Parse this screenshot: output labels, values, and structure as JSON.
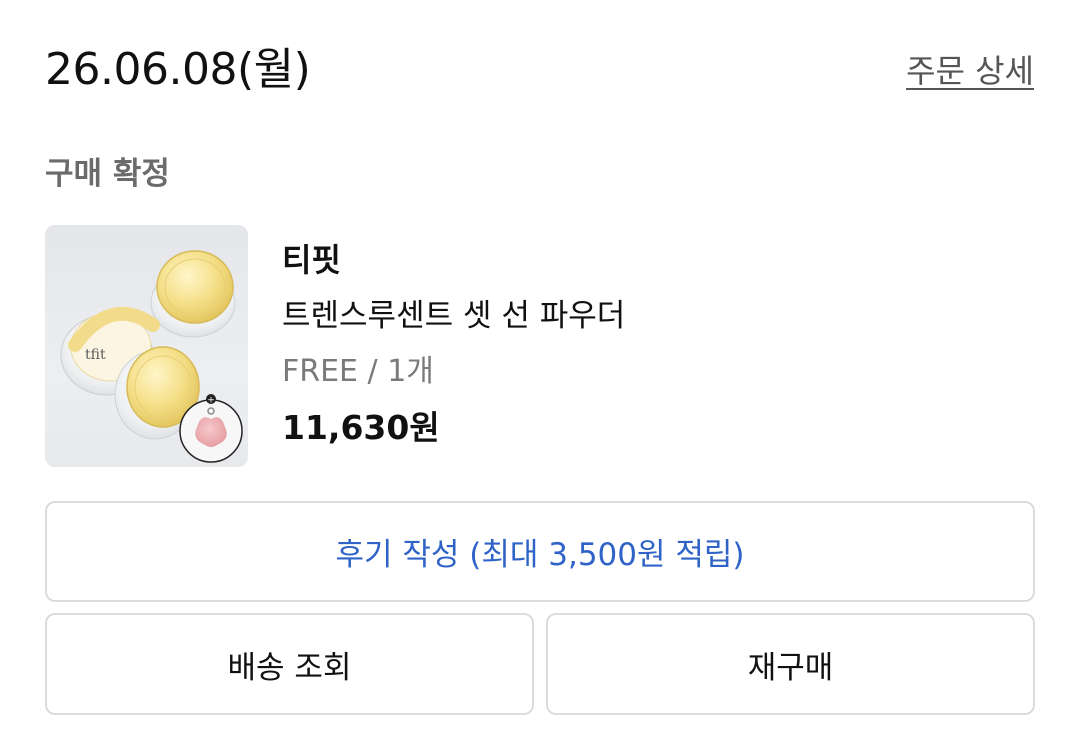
{
  "order": {
    "date": "26.06.08(월)",
    "detail_link": "주문 상세",
    "status": "구매 확정"
  },
  "product": {
    "image_icon": "loose-powder-product-image",
    "brand": "티핏",
    "name": "트렌스루센트 셋 선 파우더",
    "option": "FREE / 1개",
    "price": "11,630원"
  },
  "actions": {
    "review_label": "후기 작성 (최대 3,500원 적립)",
    "tracking_label": "배송 조회",
    "reorder_label": "재구매"
  },
  "colors": {
    "accent": "#2f63c7",
    "status_text": "#6b6b6b",
    "border": "#dcdcdc"
  }
}
